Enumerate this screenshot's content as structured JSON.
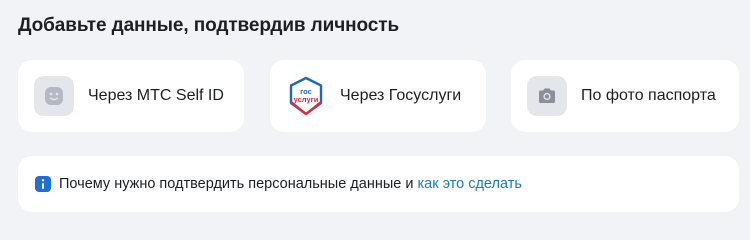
{
  "header": {
    "title": "Добавьте данные, подтвердив личность"
  },
  "options": [
    {
      "label": "Через МТС Self ID",
      "icon": "smile-face-icon"
    },
    {
      "label": "Через Госуслуги",
      "icon": "gosuslugi-logo-icon",
      "logo_text_top": "гос",
      "logo_text_bottom": "услуги"
    },
    {
      "label": "По фото паспорта",
      "icon": "camera-icon"
    }
  ],
  "info": {
    "text": "Почему нужно подтвердить персональные данные и",
    "link_label": "как это сделать",
    "icon": "info-icon"
  },
  "colors": {
    "background": "#f2f3f7",
    "card": "#ffffff",
    "icon_box": "#e4e6ec",
    "icon_gray": "#8b8f99",
    "link": "#1a7bb5",
    "info_icon": "#1e6fd9",
    "gos_blue": "#2067b8",
    "gos_red": "#e22a34"
  }
}
